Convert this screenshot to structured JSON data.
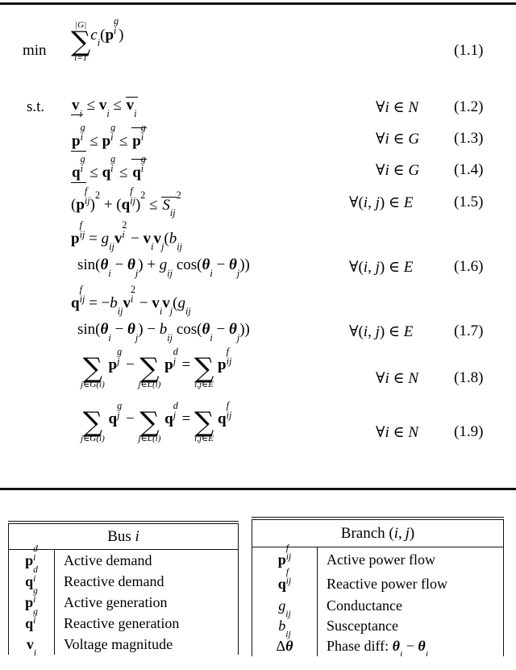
{
  "document": {
    "type": "equation-page",
    "top_rule": true,
    "mid_rule": true
  },
  "equations": {
    "objective_label": "min",
    "constraint_label": "s.t.",
    "items": [
      {
        "id": "eq-1-1",
        "number": "(1.1)",
        "quantifier": "",
        "latex": "\\min \\sum_{i=1}^{|\\mathcal{G}|} c_i(\\mathbf{p}^g_i)",
        "plain": "min sum_{i=1}^{|G|} c_i(p_i^g)",
        "sum_upper": "|G|",
        "sum_lower": "i=1"
      },
      {
        "id": "eq-1-2",
        "number": "(1.2)",
        "quantifier": "∀i ∈ N",
        "latex": "\\underline{\\mathbf{v}_i} \\le \\mathbf{v}_i \\le \\overline{\\mathbf{v}_i}",
        "plain": "v_i_lower <= v_i <= v_i_upper"
      },
      {
        "id": "eq-1-3",
        "number": "(1.3)",
        "quantifier": "∀i ∈ G",
        "latex": "\\underline{\\mathbf{p}^g_i} \\le \\mathbf{p}^g_i \\le \\overline{\\mathbf{p}^g_i}",
        "plain": "p_i^g_lower <= p_i^g <= p_i^g_upper"
      },
      {
        "id": "eq-1-4",
        "number": "(1.4)",
        "quantifier": "∀i ∈ G",
        "latex": "\\underline{\\mathbf{q}^g_i} \\le \\mathbf{q}^g_i \\le \\overline{\\mathbf{q}^g_i}",
        "plain": "q_i^g_lower <= q_i^g <= q_i^g_upper"
      },
      {
        "id": "eq-1-5",
        "number": "(1.5)",
        "quantifier": "∀(i, j) ∈ E",
        "latex": "(\\mathbf{p}^f_{ij})^2 + (\\mathbf{q}^f_{ij})^2 \\le \\overline{S_{ij}}^2",
        "plain": "(p_ij^f)^2 + (q_ij^f)^2 <= S_ij_upper^2"
      },
      {
        "id": "eq-1-6",
        "number": "(1.6)",
        "quantifier": "∀(i, j) ∈ E",
        "latex": "\\mathbf{p}^f_{ij} = g_{ij}\\mathbf{v}_i^2 - \\mathbf{v}_i\\mathbf{v}_j(b_{ij}\\sin(\\boldsymbol{\\theta}_i - \\boldsymbol{\\theta}_j) + g_{ij}\\cos(\\boldsymbol{\\theta}_i - \\boldsymbol{\\theta}_j))",
        "plain": "p_ij^f = g_ij v_i^2 - v_i v_j (b_ij sin(theta_i - theta_j) + g_ij cos(theta_i - theta_j))"
      },
      {
        "id": "eq-1-7",
        "number": "(1.7)",
        "quantifier": "∀(i, j) ∈ E",
        "latex": "\\mathbf{q}^f_{ij} = -b_{ij}\\mathbf{v}_i^2 - \\mathbf{v}_i\\mathbf{v}_j(g_{ij}\\sin(\\boldsymbol{\\theta}_i - \\boldsymbol{\\theta}_j) - b_{ij}\\cos(\\boldsymbol{\\theta}_i - \\boldsymbol{\\theta}_j))",
        "plain": "q_ij^f = -b_ij v_i^2 - v_i v_j (g_ij sin(theta_i - theta_j) - b_ij cos(theta_i - theta_j))"
      },
      {
        "id": "eq-1-8",
        "number": "(1.8)",
        "quantifier": "∀i ∈ N",
        "latex": "\\sum_{j\\in\\mathcal{G}(i)} \\mathbf{p}^g_j - \\sum_{j\\in\\mathcal{L}(i)} \\mathbf{p}^d_j = \\sum_{i,j\\in\\mathcal{E}} \\mathbf{p}^f_{ij}",
        "plain": "sum_{j in G(i)} p_j^g - sum_{j in L(i)} p_j^d = sum_{i,j in E} p_ij^f",
        "sum_limits": [
          "j∈G(i)",
          "j∈L(i)",
          "i,j∈E"
        ]
      },
      {
        "id": "eq-1-9",
        "number": "(1.9)",
        "quantifier": "∀i ∈ N",
        "latex": "\\sum_{j\\in\\mathcal{G}(i)} \\mathbf{q}^g_j - \\sum_{j\\in\\mathcal{L}(i)} \\mathbf{q}^d_j = \\sum_{i,j\\in\\mathcal{E}} \\mathbf{q}^f_{ij}",
        "plain": "sum_{j in G(i)} q_j^g - sum_{j in L(i)} q_j^d = sum_{i,j in E} q_ij^f",
        "sum_limits": [
          "j∈G(i)",
          "j∈L(i)",
          "i,j∈E"
        ]
      }
    ]
  },
  "tables": {
    "bus": {
      "header": "Bus i",
      "rows": [
        {
          "symbol": "p_i^d",
          "description": "Active demand"
        },
        {
          "symbol": "q_i^d",
          "description": "Reactive demand"
        },
        {
          "symbol": "p_i^g",
          "description": "Active generation"
        },
        {
          "symbol": "q_i^g",
          "description": "Reactive generation"
        },
        {
          "symbol": "v_i",
          "description": "Voltage magnitude"
        }
      ]
    },
    "branch": {
      "header": "Branch (i, j)",
      "rows": [
        {
          "symbol": "p_ij^f",
          "description": "Active power flow"
        },
        {
          "symbol": "q_ij^f",
          "description": "Reactive power flow"
        },
        {
          "symbol": "g_ij",
          "description": "Conductance"
        },
        {
          "symbol": "b_ij",
          "description": "Susceptance"
        },
        {
          "symbol": "Δθ",
          "description": "Phase diff: θ − θ"
        }
      ]
    }
  }
}
